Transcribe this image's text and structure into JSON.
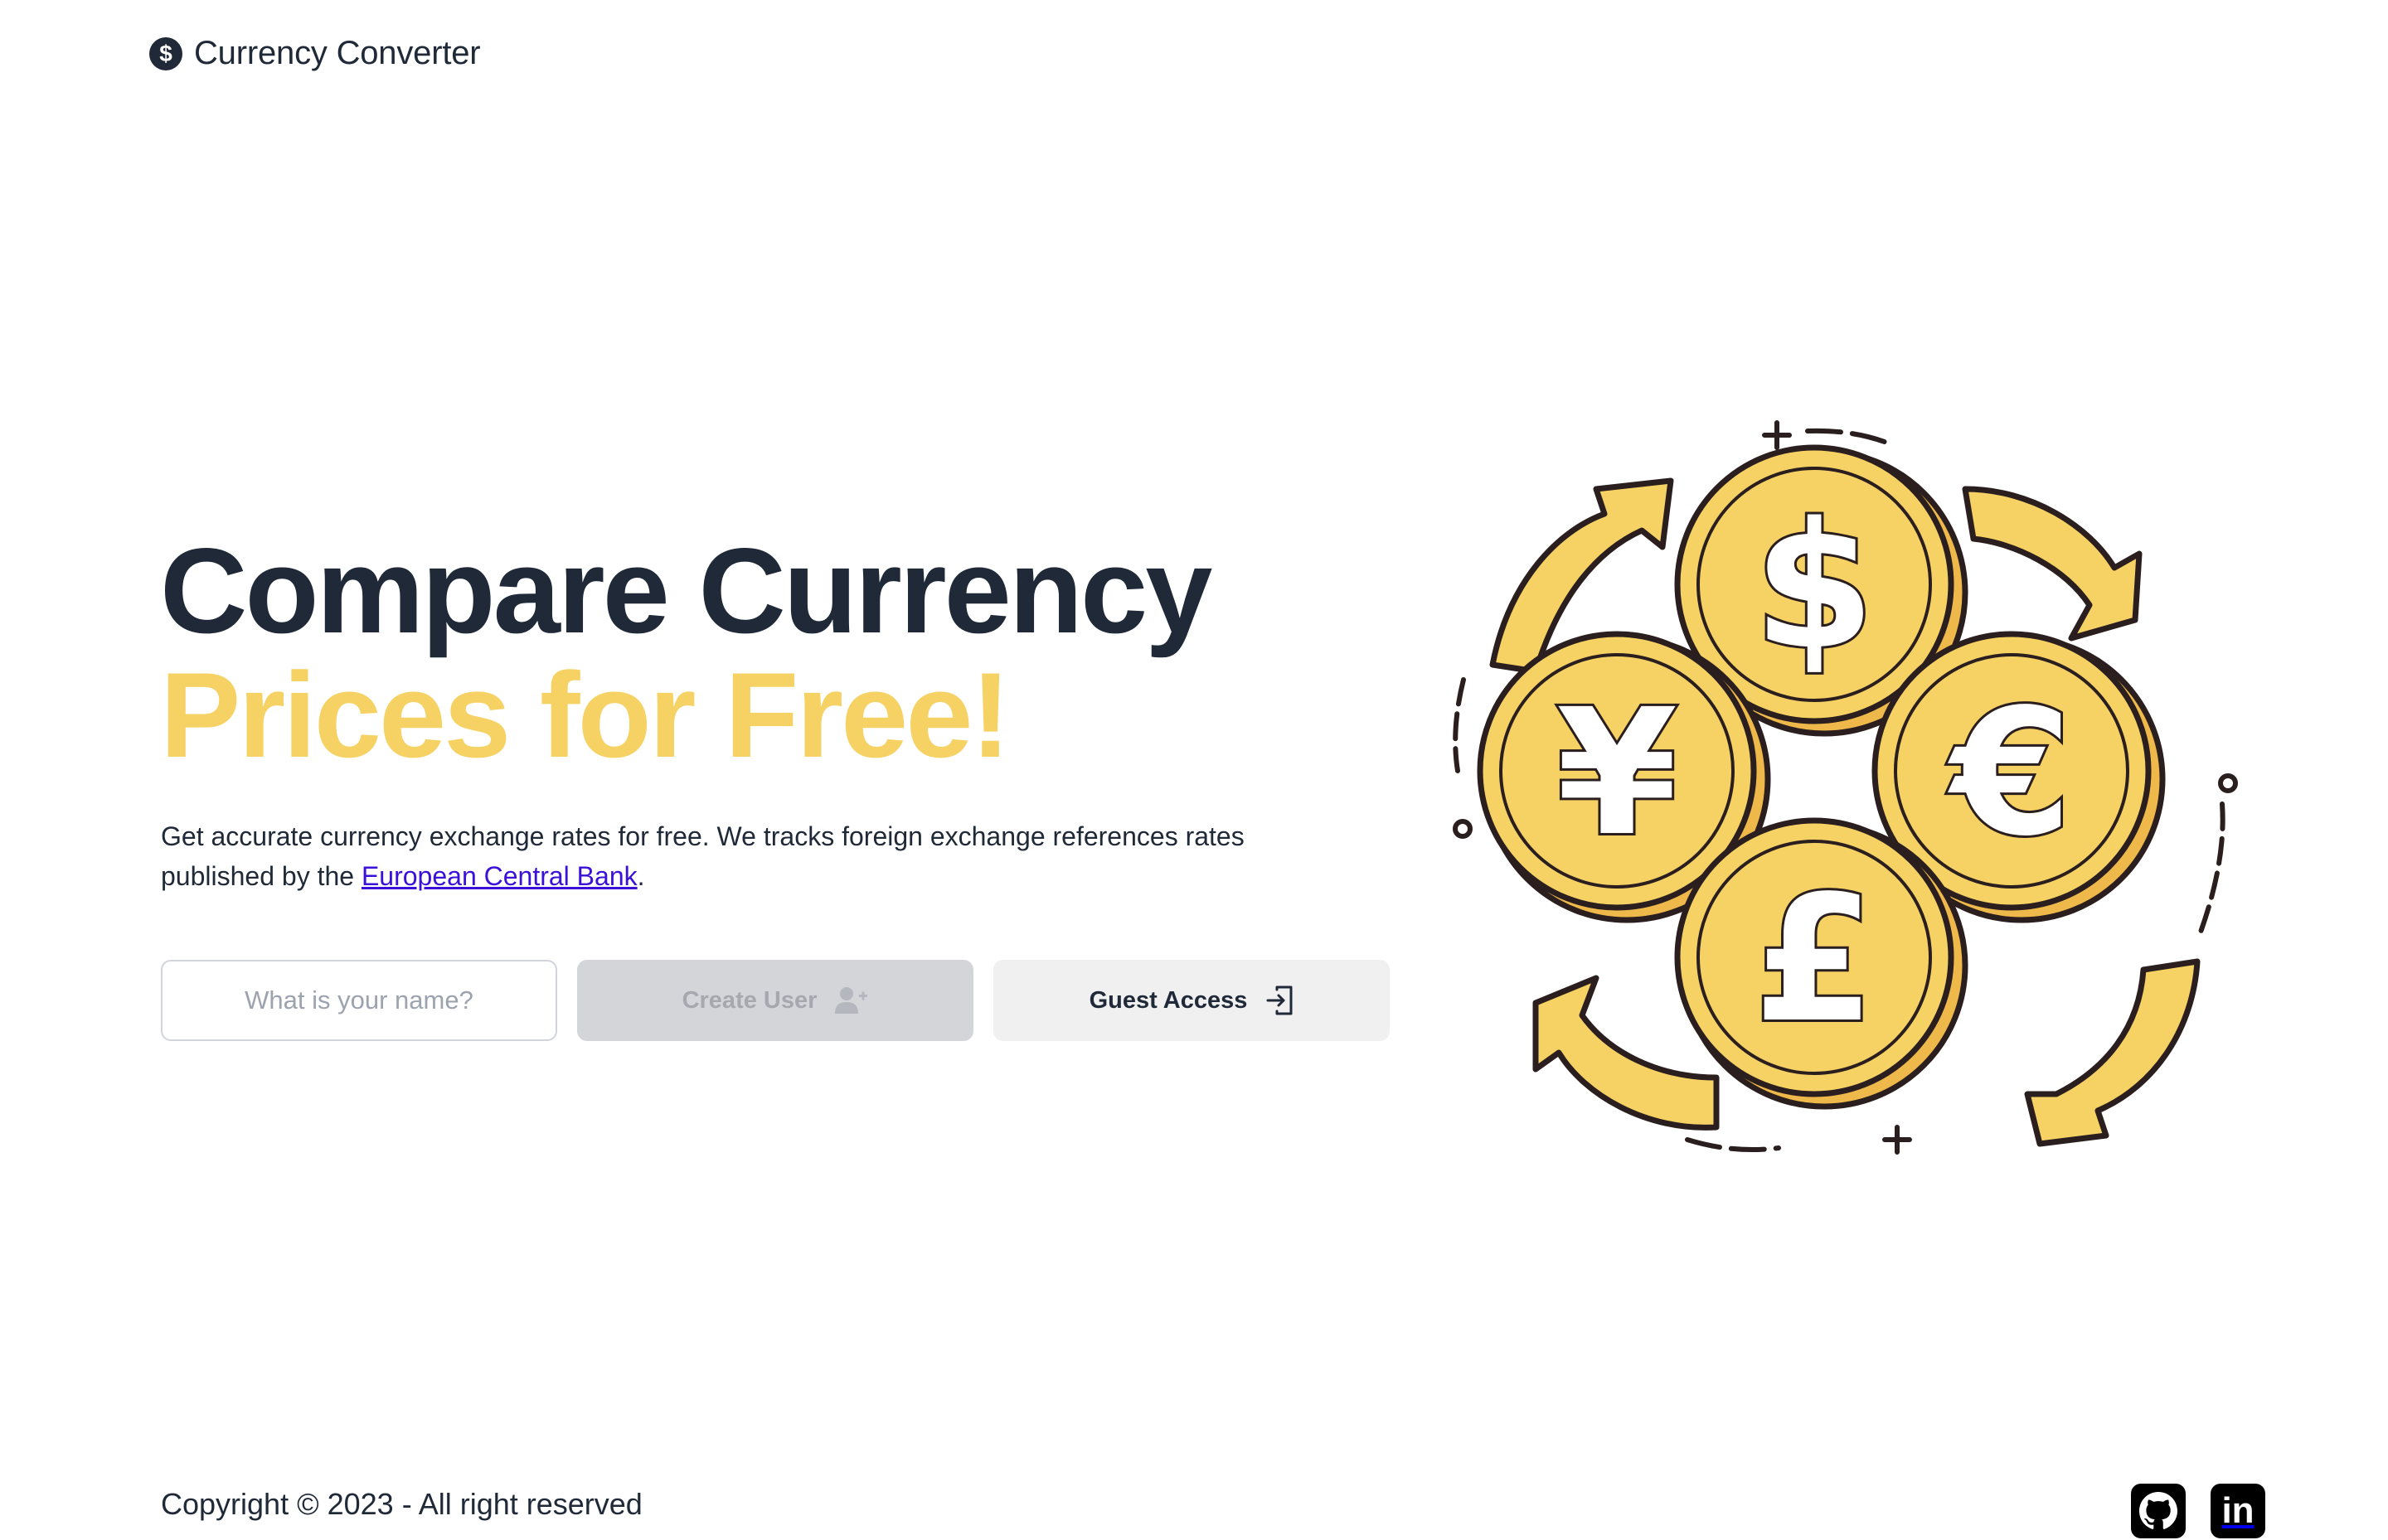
{
  "header": {
    "brand_icon": "dollar-circle-icon",
    "brand_symbol": "$",
    "title": "Currency Converter"
  },
  "hero": {
    "headline_line1": "Compare Currency",
    "headline_line2": "Prices for Free!",
    "description_prefix": "Get accurate currency exchange rates for free. We tracks foreign exchange references rates published by the ",
    "description_link": "European Central Bank",
    "description_suffix": "."
  },
  "form": {
    "name_placeholder": "What is your name?",
    "name_value": "",
    "create_user_label": "Create User",
    "create_user_icon": "user-plus-icon",
    "guest_access_label": "Guest Access",
    "guest_access_icon": "login-icon"
  },
  "illustration": {
    "symbols": [
      "$",
      "¥",
      "€",
      "£"
    ],
    "icon": "currency-exchange-illustration"
  },
  "footer": {
    "copyright": "Copyright © 2023 - All right reserved",
    "social": [
      {
        "name": "github-icon"
      },
      {
        "name": "linkedin-icon",
        "text": "in"
      }
    ]
  },
  "colors": {
    "primary_text": "#1f2937",
    "accent_yellow": "#f6d265",
    "link": "#3b10d8",
    "disabled_button": "#d4d5d9",
    "secondary_button": "#f0f0f1"
  }
}
